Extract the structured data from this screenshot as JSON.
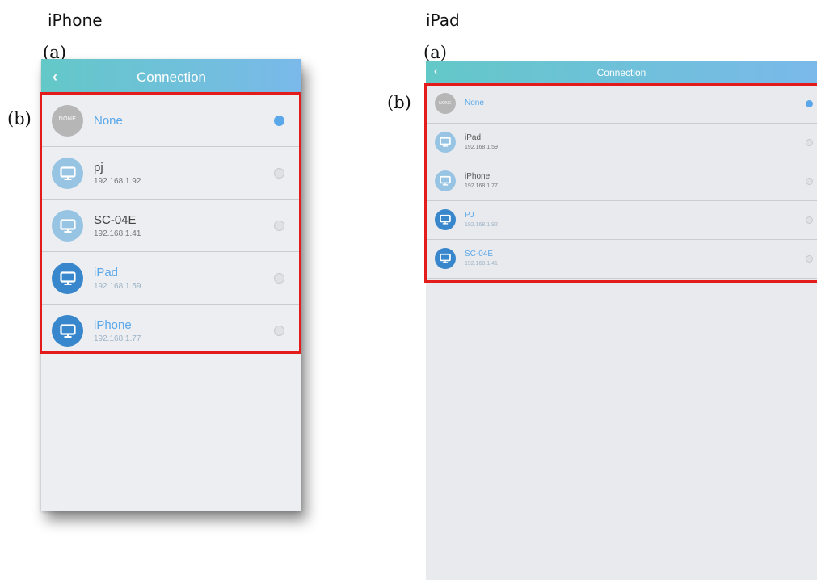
{
  "captions": {
    "left": "iPhone",
    "right": "iPad"
  },
  "markers": {
    "a": "(a)",
    "b": "(b)"
  },
  "colors": {
    "accent": "#5aa8ea",
    "highlight": "#e41b1b",
    "nav_start": "#63c8c8",
    "nav_end": "#7ab9ea"
  },
  "iphone": {
    "nav": {
      "back_icon": "chevron-left-icon",
      "back": "‹",
      "title": "Connection"
    },
    "items": [
      {
        "name": "None",
        "badge": "NONE",
        "selected": true
      },
      {
        "name": "pj",
        "ip": "192.168.1.92",
        "selected": false
      },
      {
        "name": "SC-04E",
        "ip": "192.168.1.41",
        "selected": false
      },
      {
        "name": "iPad",
        "ip": "192.168.1.59",
        "selected": false
      },
      {
        "name": "iPhone",
        "ip": "192.168.1.77",
        "selected": false
      }
    ]
  },
  "ipad": {
    "nav": {
      "back_icon": "chevron-left-icon",
      "back": "‹",
      "title": "Connection"
    },
    "items": [
      {
        "name": "None",
        "badge": "NONE",
        "selected": true
      },
      {
        "name": "iPad",
        "ip": "192.168.1.59",
        "selected": false
      },
      {
        "name": "iPhone",
        "ip": "192.168.1.77",
        "selected": false
      },
      {
        "name": "PJ",
        "ip": "192.168.1.92",
        "selected": false
      },
      {
        "name": "SC-04E",
        "ip": "192.168.1.41",
        "selected": false
      }
    ]
  }
}
